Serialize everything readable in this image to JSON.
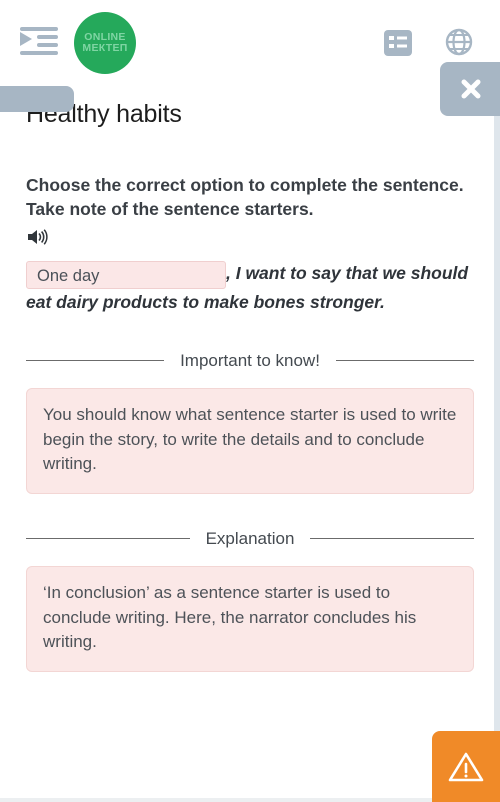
{
  "header": {
    "menu_icon": "indent-menu-icon",
    "logo": {
      "line1": "ONLINE",
      "line2": "МЕКТЕП",
      "color": "#25a95b"
    },
    "list_icon": "list-icon",
    "globe_icon": "globe-icon",
    "close_icon": "close-icon",
    "icon_color": "#a7b6c4"
  },
  "main": {
    "page_title": "Healthy habits",
    "question": "Choose the correct option to complete the sentence. Take note of the sentence starters.",
    "audio_icon": "speaker-icon",
    "answer": {
      "selected_option": "One day",
      "sentence_rest": ", I want to say that we should eat dairy products to make bones stronger."
    },
    "sections": [
      {
        "title": "Important to know!",
        "body": "You should know what sentence starter is used to write begin the story, to write the details and to conclude writing."
      },
      {
        "title": "Explanation",
        "body": "‘In conclusion’ as a sentence starter is used to conclude writing. Here, the narrator concludes his writing."
      }
    ]
  },
  "footer": {
    "warning_icon": "warning-triangle-icon",
    "warning_color": "#f08a28"
  }
}
